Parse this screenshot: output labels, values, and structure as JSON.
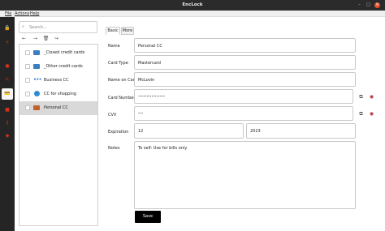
{
  "window": {
    "title": "EncLock",
    "controls": [
      "–",
      "□",
      "✕"
    ]
  },
  "menu": {
    "items": [
      "File",
      "Actions",
      "Help"
    ]
  },
  "rail": {
    "icons": [
      {
        "name": "lock-icon",
        "glyph": "🔒"
      },
      {
        "name": "add-icon",
        "glyph": "+"
      },
      {
        "name": "person-icon",
        "glyph": "●"
      },
      {
        "name": "note-icon",
        "glyph": "✎"
      },
      {
        "name": "credit-card-icon",
        "glyph": "💳"
      },
      {
        "name": "document-icon",
        "glyph": "■"
      },
      {
        "name": "key-icon",
        "glyph": "⚷"
      },
      {
        "name": "shield-icon",
        "glyph": "◆"
      }
    ]
  },
  "search": {
    "placeholder": "Search..."
  },
  "toolbar": {
    "back": "←",
    "forward": "→",
    "delete": "🗑",
    "move": "↪"
  },
  "list": {
    "items": [
      {
        "label": "_Closed credit cards",
        "icon": "folder"
      },
      {
        "label": "_Other credit cards",
        "icon": "folder"
      },
      {
        "label": "Business CC",
        "icon": "dots"
      },
      {
        "label": "CC for shopping",
        "icon": "globe"
      },
      {
        "label": "Personal CC",
        "icon": "card",
        "selected": true
      }
    ]
  },
  "tabs": {
    "basic": "Basic",
    "more": "More"
  },
  "form": {
    "name_label": "Name",
    "name_value": "Personal CC",
    "card_type_label": "Card Type",
    "card_type_value": "Mastercard",
    "name_on_card_label": "Name on Card",
    "name_on_card_value": "McLovin",
    "card_number_label": "Card Number",
    "card_number_value": "••••••••••••••••",
    "cvv_label": "CVV",
    "cvv_value": "•••",
    "expiration_label": "Expiration",
    "expiration_month": "12",
    "expiration_year": "2023",
    "notes_label": "Notes",
    "notes_value": "To self: Use for bills only",
    "save_label": "Save"
  },
  "colors": {
    "accent": "#d1331c",
    "rail_bg": "#252525",
    "title_bg": "#2b2b2b",
    "close_button": "#e9542a",
    "selection": "#d9d9d9"
  }
}
